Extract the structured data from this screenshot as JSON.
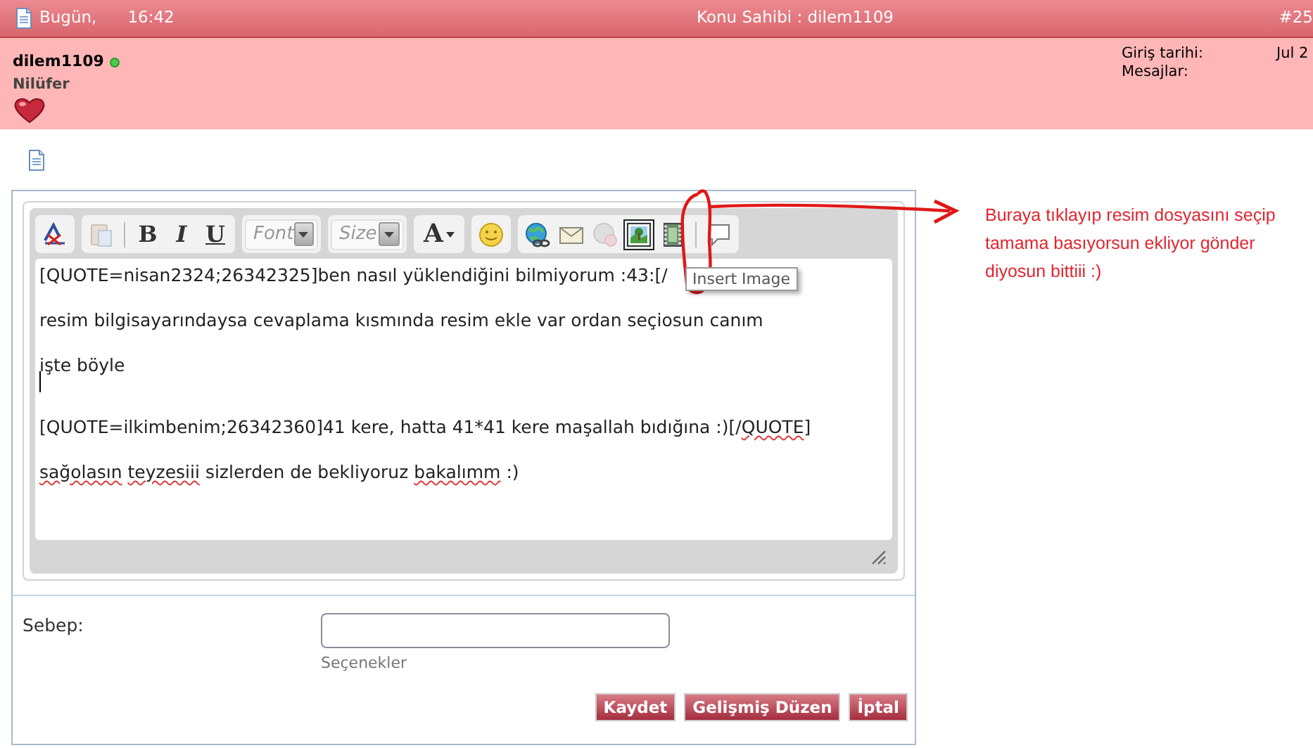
{
  "header": {
    "date": "Bugün,",
    "time": "16:42",
    "thread_starter": "Konu Sahibi : dilem1109",
    "post_number": "#25"
  },
  "user": {
    "name": "dilem1109",
    "online": true,
    "location": "Nilüfer",
    "stats": [
      {
        "label": "Giriş tarihi:",
        "value": "Jul 2"
      },
      {
        "label": "Mesajlar:"
      }
    ]
  },
  "editor": {
    "toolbar_groups": [
      [
        {
          "kind": "remove-format",
          "disabled": false,
          "hovered": false
        }
      ],
      [
        {
          "kind": "paste",
          "disabled": true,
          "hovered": false
        },
        {
          "kind": "separator"
        },
        {
          "kind": "bold",
          "label": "B",
          "disabled": false,
          "hovered": false
        },
        {
          "kind": "italic",
          "label": "I",
          "disabled": false,
          "hovered": false
        },
        {
          "kind": "underline",
          "label": "U",
          "disabled": false,
          "hovered": false
        }
      ],
      [
        {
          "kind": "select",
          "placeholder": "Font"
        }
      ],
      [
        {
          "kind": "select",
          "placeholder": "Size"
        }
      ],
      [
        {
          "kind": "text-color",
          "label": "A",
          "disabled": false,
          "hovered": false
        }
      ],
      [
        {
          "kind": "smilies",
          "disabled": false,
          "hovered": false
        }
      ],
      [
        {
          "kind": "link",
          "disabled": false,
          "hovered": false
        },
        {
          "kind": "email",
          "disabled": false,
          "hovered": false
        },
        {
          "kind": "unlink",
          "disabled": true,
          "hovered": false
        },
        {
          "kind": "image",
          "disabled": false,
          "hovered": true
        },
        {
          "kind": "video",
          "disabled": false,
          "hovered": false
        },
        {
          "kind": "separator"
        },
        {
          "kind": "quote",
          "disabled": false,
          "hovered": false
        }
      ]
    ],
    "tooltip": "Insert Image",
    "lines": [
      {
        "kind": "text",
        "segments": [
          {
            "text": "[QUOTE=nisan2324;26342325]ben nasıl yüklendiğini bilmiyorum :43:[/",
            "misspelled": false
          }
        ]
      },
      {
        "kind": "text",
        "segments": [
          {
            "text": "resim bilgisayarındaysa cevaplama kısmında resim ekle var ordan seçiosun canım",
            "misspelled": false
          }
        ]
      },
      {
        "kind": "text",
        "segments": [
          {
            "text": "işte böyle",
            "misspelled": false
          }
        ]
      },
      {
        "kind": "cursor"
      },
      {
        "kind": "text",
        "segments": [
          {
            "text": "[QUOTE=ilkimbenim;26342360]41 kere, hatta 41*41 kere maşallah bıdığına :)[/",
            "misspelled": false
          },
          {
            "text": "QUOTE",
            "misspelled": true
          },
          {
            "text": "]",
            "misspelled": false
          }
        ]
      },
      {
        "kind": "text",
        "segments": [
          {
            "text": "sağolasın",
            "misspelled": true
          },
          {
            "text": "teyzesiii",
            "misspelled": true,
            "space_before": true
          },
          {
            "text": "sizlerden de bekliyoruz",
            "misspelled": false,
            "space_before": true
          },
          {
            "text": "bakalımm",
            "misspelled": true,
            "space_before": true
          },
          {
            "text": ":)",
            "misspelled": false,
            "space_before": true
          }
        ]
      }
    ]
  },
  "reason": {
    "label": "Sebep:",
    "options_link": "Seçenekler"
  },
  "buttons": [
    "Kaydet",
    "Gelişmiş Düzen",
    "İptal"
  ],
  "annotation": "Buraya tıklayıp resim dosyasını seçip tamama basıyorsun ekliyor gönder diyosun bittiii :)"
}
